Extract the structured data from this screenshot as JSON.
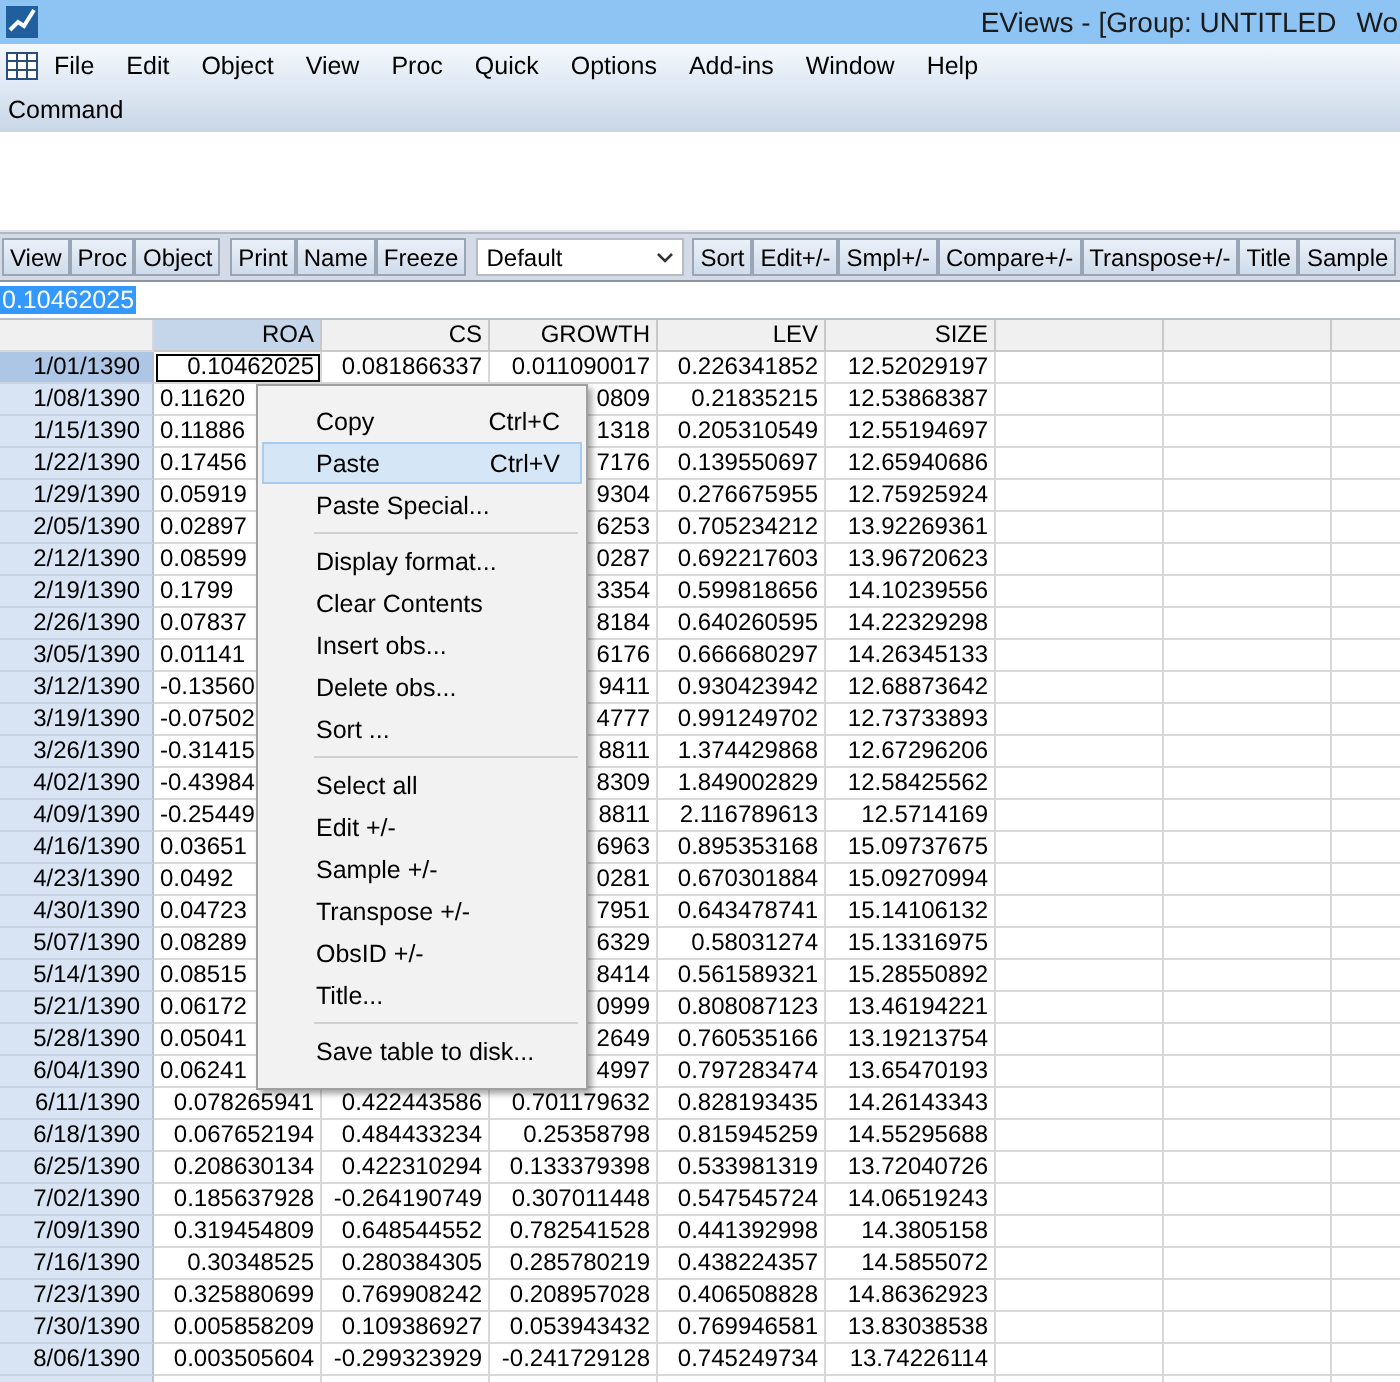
{
  "window": {
    "title": "EViews - [Group: UNTITLED",
    "title_cut": "Wo"
  },
  "menu_bar": [
    "File",
    "Edit",
    "Object",
    "View",
    "Proc",
    "Quick",
    "Options",
    "Add-ins",
    "Window",
    "Help"
  ],
  "command_label": "Command",
  "toolbar": [
    {
      "kind": "button",
      "label": "View"
    },
    {
      "kind": "button",
      "label": "Proc"
    },
    {
      "kind": "button",
      "label": "Object"
    },
    {
      "kind": "gap"
    },
    {
      "kind": "button",
      "label": "Print"
    },
    {
      "kind": "button",
      "label": "Name"
    },
    {
      "kind": "button",
      "label": "Freeze"
    },
    {
      "kind": "select",
      "label": "Default"
    },
    {
      "kind": "button",
      "label": "Sort"
    },
    {
      "kind": "button",
      "label": "Edit+/-"
    },
    {
      "kind": "button",
      "label": "Smpl+/-"
    },
    {
      "kind": "button",
      "label": "Compare+/-"
    },
    {
      "kind": "button",
      "label": "Transpose+/-"
    },
    {
      "kind": "button",
      "label": "Title"
    },
    {
      "kind": "button",
      "label": "Sample"
    }
  ],
  "edit_field": {
    "value": "0.10462025"
  },
  "table": {
    "columns": [
      {
        "label": "ROA",
        "selected": true
      },
      {
        "label": "CS",
        "selected": false
      },
      {
        "label": "GROWTH",
        "selected": false
      },
      {
        "label": "LEV",
        "selected": false
      },
      {
        "label": "SIZE",
        "selected": false
      }
    ],
    "rows": [
      {
        "label": "1/01/1390",
        "kind": "full",
        "selected": true,
        "cells": [
          "0.10462025",
          "0.081866337",
          "0.011090017",
          "0.226341852",
          "12.52029197"
        ]
      },
      {
        "label": "1/08/1390",
        "kind": "covered",
        "selected": false,
        "cells": [
          "0.11620",
          null,
          "0809",
          "0.21835215",
          "12.53868387"
        ]
      },
      {
        "label": "1/15/1390",
        "kind": "covered",
        "selected": false,
        "cells": [
          "0.11886",
          null,
          "1318",
          "0.205310549",
          "12.55194697"
        ]
      },
      {
        "label": "1/22/1390",
        "kind": "covered",
        "selected": false,
        "cells": [
          "0.17456",
          null,
          "7176",
          "0.139550697",
          "12.65940686"
        ]
      },
      {
        "label": "1/29/1390",
        "kind": "covered",
        "selected": false,
        "cells": [
          "0.05919",
          null,
          "9304",
          "0.276675955",
          "12.75925924"
        ]
      },
      {
        "label": "2/05/1390",
        "kind": "covered",
        "selected": false,
        "cells": [
          "0.02897",
          null,
          "6253",
          "0.705234212",
          "13.92269361"
        ]
      },
      {
        "label": "2/12/1390",
        "kind": "covered",
        "selected": false,
        "cells": [
          "0.08599",
          null,
          "0287",
          "0.692217603",
          "13.96720623"
        ]
      },
      {
        "label": "2/19/1390",
        "kind": "covered",
        "selected": false,
        "cells": [
          "0.1799",
          null,
          "3354",
          "0.599818656",
          "14.10239556"
        ]
      },
      {
        "label": "2/26/1390",
        "kind": "covered",
        "selected": false,
        "cells": [
          "0.07837",
          null,
          "8184",
          "0.640260595",
          "14.22329298"
        ]
      },
      {
        "label": "3/05/1390",
        "kind": "covered",
        "selected": false,
        "cells": [
          "0.01141",
          null,
          "6176",
          "0.666680297",
          "14.26345133"
        ]
      },
      {
        "label": "3/12/1390",
        "kind": "covered",
        "selected": false,
        "cells": [
          "-0.13560",
          null,
          "9411",
          "0.930423942",
          "12.68873642"
        ]
      },
      {
        "label": "3/19/1390",
        "kind": "covered",
        "selected": false,
        "cells": [
          "-0.07502",
          null,
          "4777",
          "0.991249702",
          "12.73733893"
        ]
      },
      {
        "label": "3/26/1390",
        "kind": "covered",
        "selected": false,
        "cells": [
          "-0.31415",
          null,
          "8811",
          "1.374429868",
          "12.67296206"
        ]
      },
      {
        "label": "4/02/1390",
        "kind": "covered",
        "selected": false,
        "cells": [
          "-0.43984",
          null,
          "8309",
          "1.849002829",
          "12.58425562"
        ]
      },
      {
        "label": "4/09/1390",
        "kind": "covered",
        "selected": false,
        "cells": [
          "-0.25449",
          null,
          "8811",
          "2.116789613",
          "12.5714169"
        ]
      },
      {
        "label": "4/16/1390",
        "kind": "covered",
        "selected": false,
        "cells": [
          "0.03651",
          null,
          "6963",
          "0.895353168",
          "15.09737675"
        ]
      },
      {
        "label": "4/23/1390",
        "kind": "covered",
        "selected": false,
        "cells": [
          "0.0492",
          null,
          "0281",
          "0.670301884",
          "15.09270994"
        ]
      },
      {
        "label": "4/30/1390",
        "kind": "covered",
        "selected": false,
        "cells": [
          "0.04723",
          null,
          "7951",
          "0.643478741",
          "15.14106132"
        ]
      },
      {
        "label": "5/07/1390",
        "kind": "covered",
        "selected": false,
        "cells": [
          "0.08289",
          null,
          "6329",
          "0.58031274",
          "15.13316975"
        ]
      },
      {
        "label": "5/14/1390",
        "kind": "covered",
        "selected": false,
        "cells": [
          "0.08515",
          null,
          "8414",
          "0.561589321",
          "15.28550892"
        ]
      },
      {
        "label": "5/21/1390",
        "kind": "covered",
        "selected": false,
        "cells": [
          "0.06172",
          null,
          "0999",
          "0.808087123",
          "13.46194221"
        ]
      },
      {
        "label": "5/28/1390",
        "kind": "covered",
        "selected": false,
        "cells": [
          "0.05041",
          null,
          "2649",
          "0.760535166",
          "13.19213754"
        ]
      },
      {
        "label": "6/04/1390",
        "kind": "covered",
        "selected": false,
        "cells": [
          "0.06241",
          null,
          "4997",
          "0.797283474",
          "13.65470193"
        ]
      },
      {
        "label": "6/11/1390",
        "kind": "full",
        "selected": false,
        "cells": [
          "0.078265941",
          "0.422443586",
          "0.701179632",
          "0.828193435",
          "14.26143343"
        ]
      },
      {
        "label": "6/18/1390",
        "kind": "full",
        "selected": false,
        "cells": [
          "0.067652194",
          "0.484433234",
          "0.25358798",
          "0.815945259",
          "14.55295688"
        ]
      },
      {
        "label": "6/25/1390",
        "kind": "full",
        "selected": false,
        "cells": [
          "0.208630134",
          "0.422310294",
          "0.133379398",
          "0.533981319",
          "13.72040726"
        ]
      },
      {
        "label": "7/02/1390",
        "kind": "full",
        "selected": false,
        "cells": [
          "0.185637928",
          "-0.264190749",
          "0.307011448",
          "0.547545724",
          "14.06519243"
        ]
      },
      {
        "label": "7/09/1390",
        "kind": "full",
        "selected": false,
        "cells": [
          "0.319454809",
          "0.648544552",
          "0.782541528",
          "0.441392998",
          "14.3805158"
        ]
      },
      {
        "label": "7/16/1390",
        "kind": "full",
        "selected": false,
        "cells": [
          "0.30348525",
          "0.280384305",
          "0.285780219",
          "0.438224357",
          "14.5855072"
        ]
      },
      {
        "label": "7/23/1390",
        "kind": "full",
        "selected": false,
        "cells": [
          "0.325880699",
          "0.769908242",
          "0.208957028",
          "0.406508828",
          "14.86362923"
        ]
      },
      {
        "label": "7/30/1390",
        "kind": "full",
        "selected": false,
        "cells": [
          "0.005858209",
          "0.109386927",
          "0.053943432",
          "0.769946581",
          "13.83038538"
        ]
      },
      {
        "label": "8/06/1390",
        "kind": "full",
        "selected": false,
        "cells": [
          "0.003505604",
          "-0.299323929",
          "-0.241729128",
          "0.745249734",
          "13.74226114"
        ]
      }
    ]
  },
  "context_menu": [
    {
      "kind": "item",
      "label": "Copy",
      "shortcut": "Ctrl+C",
      "selected": false
    },
    {
      "kind": "item",
      "label": "Paste",
      "shortcut": "Ctrl+V",
      "selected": true
    },
    {
      "kind": "item",
      "label": "Paste Special...",
      "selected": false
    },
    {
      "kind": "separator"
    },
    {
      "kind": "item",
      "label": "Display format...",
      "selected": false
    },
    {
      "kind": "item",
      "label": "Clear Contents",
      "selected": false
    },
    {
      "kind": "item",
      "label": "Insert obs...",
      "selected": false
    },
    {
      "kind": "item",
      "label": "Delete obs...",
      "selected": false
    },
    {
      "kind": "item",
      "label": "Sort ...",
      "selected": false
    },
    {
      "kind": "separator"
    },
    {
      "kind": "item",
      "label": "Select all",
      "selected": false
    },
    {
      "kind": "item",
      "label": "Edit +/-",
      "selected": false
    },
    {
      "kind": "item",
      "label": "Sample +/-",
      "selected": false
    },
    {
      "kind": "item",
      "label": "Transpose +/-",
      "selected": false
    },
    {
      "kind": "item",
      "label": "ObsID +/-",
      "selected": false
    },
    {
      "kind": "item",
      "label": "Title...",
      "selected": false
    },
    {
      "kind": "separator"
    },
    {
      "kind": "item",
      "label": "Save table to disk...",
      "selected": false
    }
  ]
}
